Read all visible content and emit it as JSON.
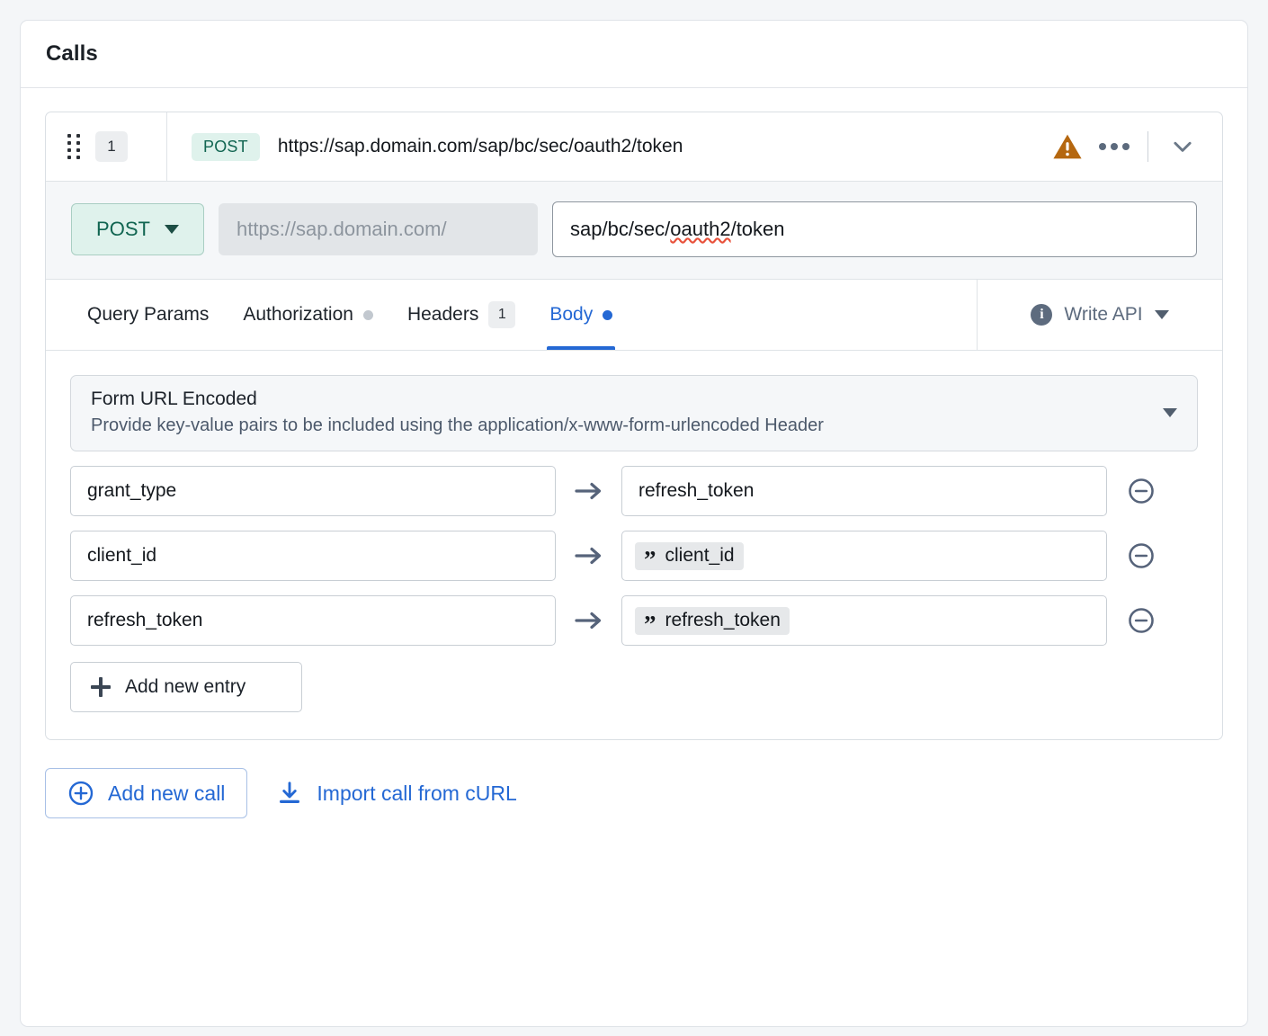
{
  "panel": {
    "title": "Calls"
  },
  "call": {
    "index": "1",
    "method_badge": "POST",
    "url": "https://sap.domain.com/sap/bc/sec/oauth2/token",
    "warning_icon": "warning-triangle-icon",
    "more_icon": "more-options-icon",
    "collapse_icon": "chevron-down-icon"
  },
  "url_editor": {
    "method": "POST",
    "host_value": "https://sap.domain.com/",
    "path_value": "sap/bc/sec/oauth2/token",
    "path_prefix": "sap/bc/sec/",
    "path_misspelled": "oauth2",
    "path_suffix": "/token"
  },
  "tabs": [
    {
      "label": "Query Params",
      "marker": "",
      "active": false
    },
    {
      "label": "Authorization",
      "marker": "dot-gray",
      "active": false
    },
    {
      "label": "Headers",
      "marker": "badge",
      "badge": "1",
      "active": false
    },
    {
      "label": "Body",
      "marker": "dot-blue",
      "active": true
    }
  ],
  "tabs_right": {
    "label": "Write API",
    "info_icon": "info-icon",
    "caret_icon": "chevron-down-icon"
  },
  "body": {
    "encoding_title": "Form URL Encoded",
    "encoding_subtitle": "Provide key-value pairs to be included using the application/x-www-form-urlencoded Header",
    "entries": [
      {
        "key": "grant_type",
        "value": "refresh_token",
        "is_token": false
      },
      {
        "key": "client_id",
        "value": "client_id",
        "is_token": true
      },
      {
        "key": "refresh_token",
        "value": "refresh_token",
        "is_token": true
      }
    ],
    "add_entry_label": "Add new entry",
    "remove_icon": "remove-circle-icon",
    "arrow_icon": "arrow-right-icon",
    "token_quote_glyph": "”"
  },
  "footer": {
    "add_call_label": "Add new call",
    "add_call_icon": "plus-circle-icon",
    "import_curl_label": "Import call from cURL",
    "import_curl_icon": "download-icon"
  },
  "colors": {
    "accent_blue": "#2468d4",
    "method_green_text": "#116551",
    "method_green_bg": "#dff2ec",
    "warning_orange": "#b5670f",
    "slate": "#5d6b7e",
    "page_bg": "#f4f6f8"
  }
}
